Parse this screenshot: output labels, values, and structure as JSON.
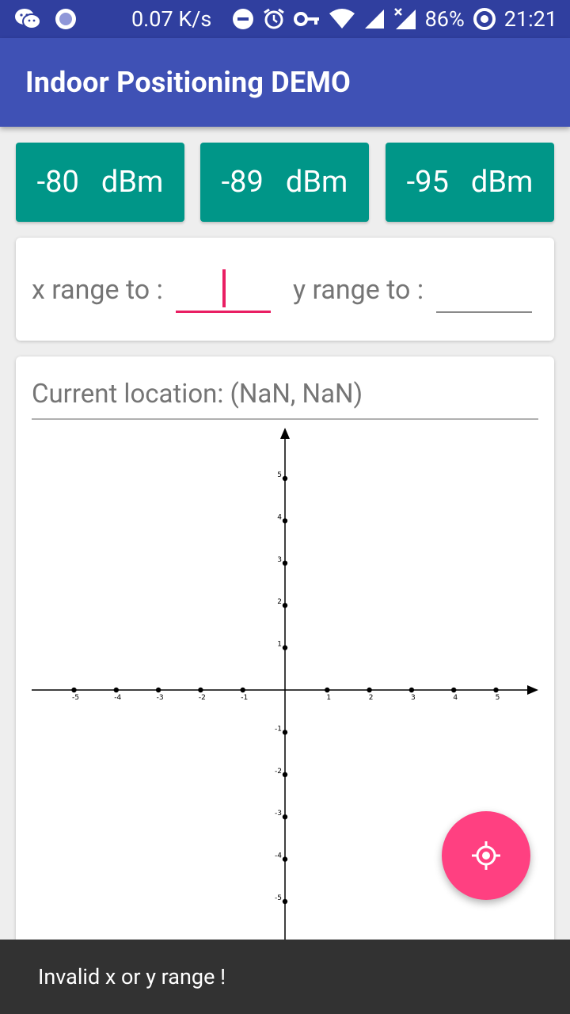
{
  "status_bar": {
    "speed": "0.07 K/s",
    "battery": "86%",
    "time": "21:21",
    "icons": [
      "wechat-icon",
      "record-icon",
      "dnd-icon",
      "alarm-icon",
      "key-icon",
      "wifi-icon",
      "signal-icon",
      "signal-no-data-icon",
      "battery-saver-icon"
    ]
  },
  "app_bar": {
    "title": "Indoor Positioning DEMO"
  },
  "rssi": [
    {
      "value": "-80",
      "unit": "dBm"
    },
    {
      "value": "-89",
      "unit": "dBm"
    },
    {
      "value": "-95",
      "unit": "dBm"
    }
  ],
  "range": {
    "x_label": "x range to :",
    "x_value": "",
    "y_label": "y range to :",
    "y_value": ""
  },
  "location": {
    "text": "Current location:  (NaN, NaN)"
  },
  "fab": {
    "icon": "my-location-icon"
  },
  "snackbar": {
    "text": "Invalid x or y range !"
  },
  "chart_data": {
    "type": "scatter",
    "x_ticks": [
      -5,
      -4,
      -3,
      -2,
      -1,
      1,
      2,
      3,
      4,
      5
    ],
    "y_ticks": [
      -5,
      -4,
      -3,
      -2,
      -1,
      1,
      2,
      3,
      4,
      5
    ],
    "xlim": [
      -5.6,
      5.8
    ],
    "ylim": [
      -5.8,
      6.2
    ],
    "points": [],
    "title": "",
    "xlabel": "",
    "ylabel": ""
  }
}
